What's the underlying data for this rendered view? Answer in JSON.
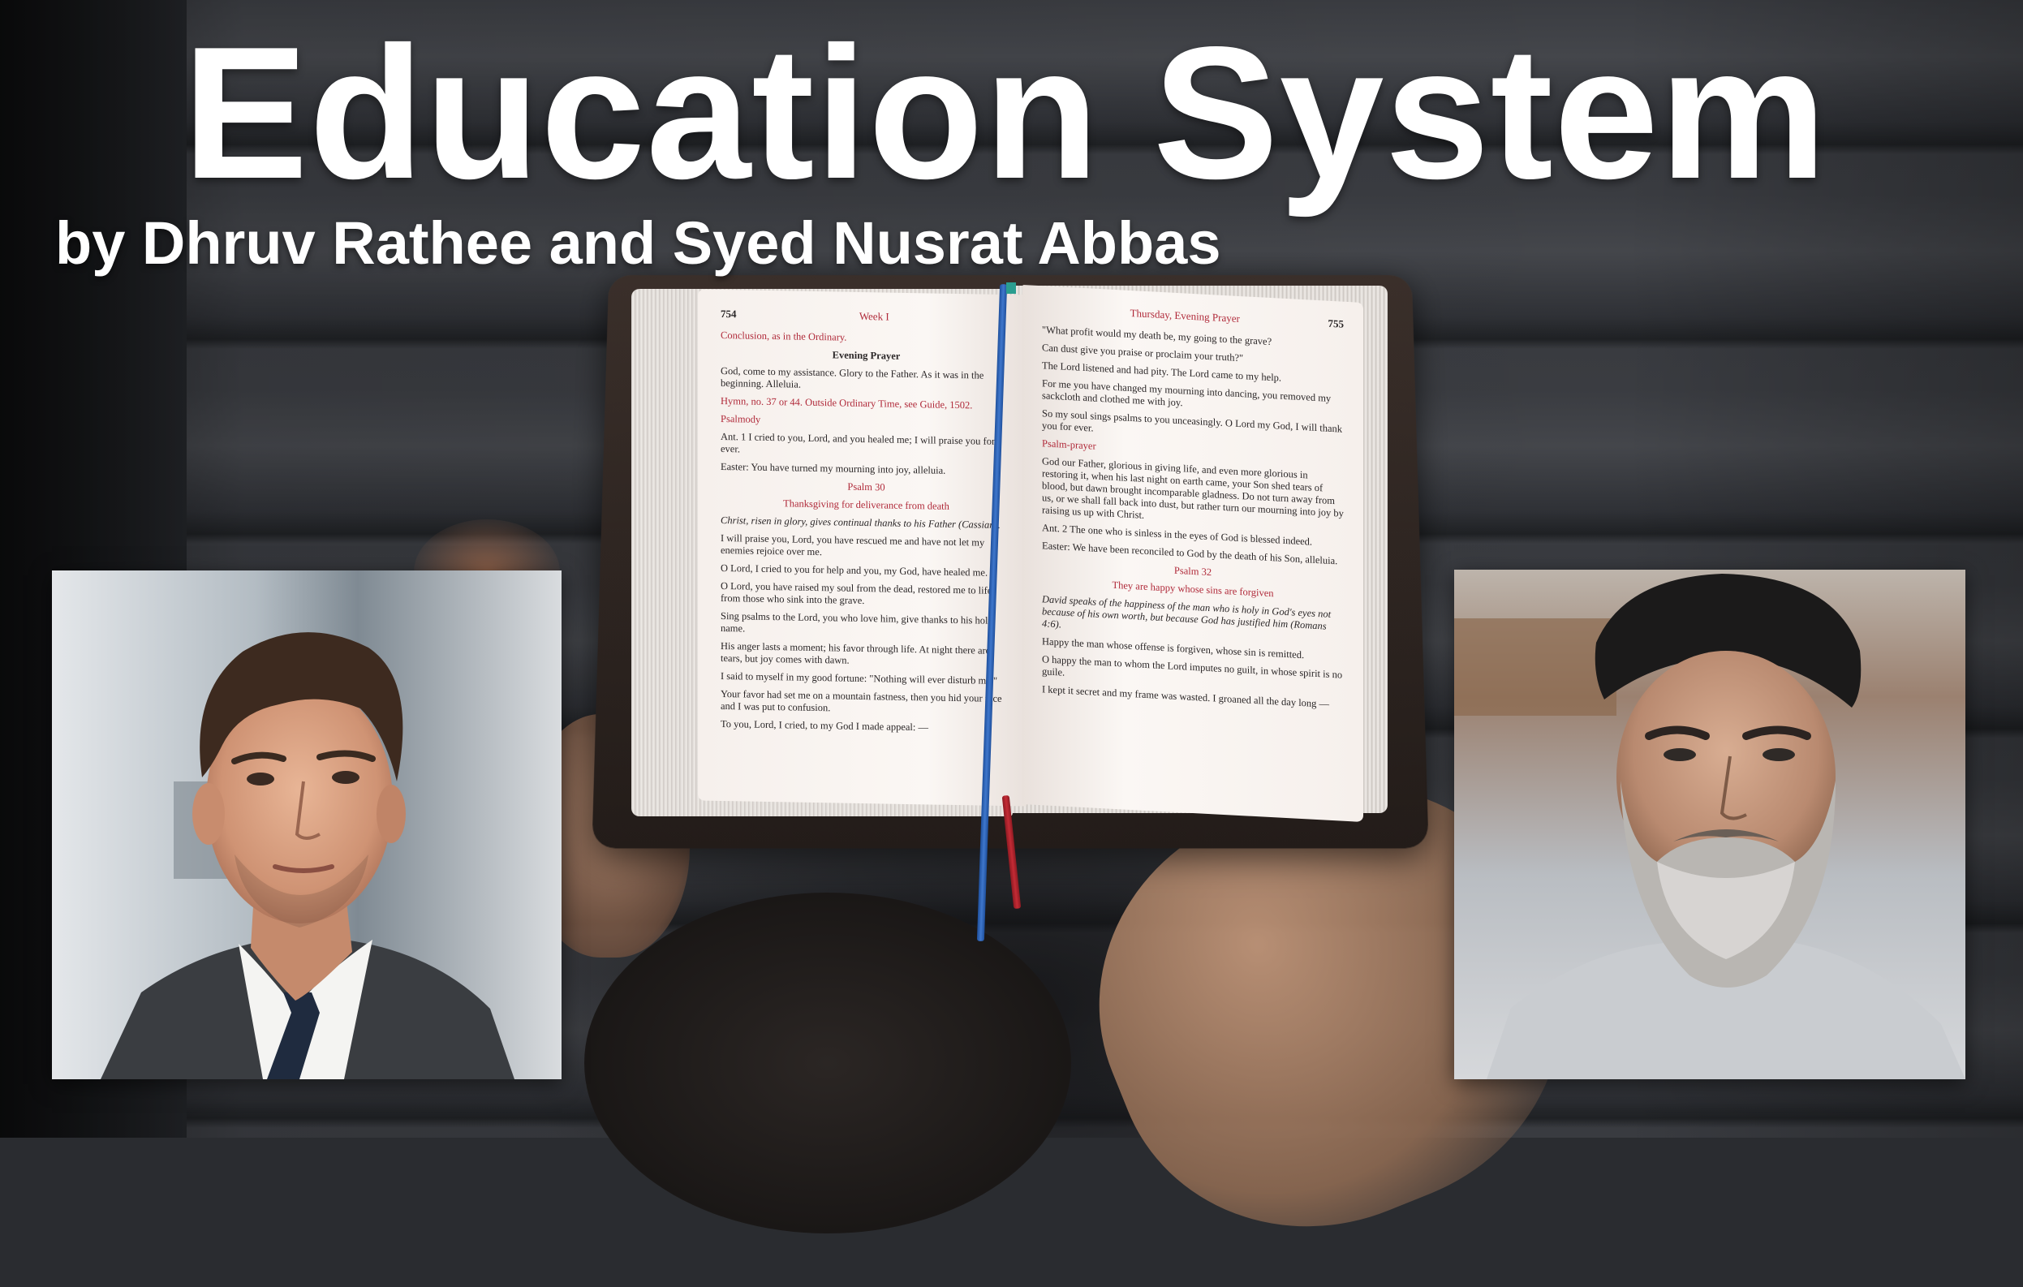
{
  "headline": {
    "title": "Education System",
    "subtitle": "by Dhruv Rathee and Syed Nusrat Abbas"
  },
  "book": {
    "left_page": {
      "page_number": "754",
      "running_head": "Week I",
      "line_1": "Conclusion, as in the Ordinary.",
      "heading": "Evening Prayer",
      "line_2": "God, come to my assistance. Glory to the Father. As it was in the beginning. Alleluia.",
      "line_3": "Hymn, no. 37 or 44. Outside Ordinary Time, see Guide, 1502.",
      "line_4": "Psalmody",
      "line_5": "Ant. 1  I cried to you, Lord, and you healed me; I will praise you for ever.",
      "line_6": "Easter: You have turned my mourning into joy, alleluia.",
      "line_7": "Psalm 30",
      "line_8": "Thanksgiving for deliverance from death",
      "line_9": "Christ, risen in glory, gives continual thanks to his Father (Cassian).",
      "line_10": "I will praise you, Lord, you have rescued me and have not let my enemies rejoice over me.",
      "line_11": "O Lord, I cried to you for help and you, my God, have healed me.",
      "line_12": "O Lord, you have raised my soul from the dead, restored me to life from those who sink into the grave.",
      "line_13": "Sing psalms to the Lord, you who love him, give thanks to his holy name.",
      "line_14": "His anger lasts a moment; his favor through life. At night there are tears, but joy comes with dawn.",
      "line_15": "I said to myself in my good fortune: \"Nothing will ever disturb me.\"",
      "line_16": "Your favor had set me on a mountain fastness, then you hid your face and I was put to confusion.",
      "line_17": "To you, Lord, I cried, to my God I made appeal: —"
    },
    "right_page": {
      "running_head": "Thursday, Evening Prayer",
      "page_number": "755",
      "line_1": "\"What profit would my death be, my going to the grave?",
      "line_2": "Can dust give you praise or proclaim your truth?\"",
      "line_3": "The Lord listened and had pity. The Lord came to my help.",
      "line_4": "For me you have changed my mourning into dancing, you removed my sackcloth and clothed me with joy.",
      "line_5": "So my soul sings psalms to you unceasingly. O Lord my God, I will thank you for ever.",
      "line_6": "Psalm-prayer",
      "line_7": "God our Father, glorious in giving life, and even more glorious in restoring it, when his last night on earth came, your Son shed tears of blood, but dawn brought incomparable gladness. Do not turn away from us, or we shall fall back into dust, but rather turn our mourning into joy by raising us up with Christ.",
      "line_8": "Ant. 2  The one who is sinless in the eyes of God is blessed indeed.",
      "line_9": "Easter: We have been reconciled to God by the death of his Son, alleluia.",
      "line_10": "Psalm 32",
      "line_11": "They are happy whose sins are forgiven",
      "line_12": "David speaks of the happiness of the man who is holy in God's eyes not because of his own worth, but because God has justified him (Romans 4:6).",
      "line_13": "Happy the man whose offense is forgiven, whose sin is remitted.",
      "line_14": "O happy the man to whom the Lord imputes no guilt, in whose spirit is no guile.",
      "line_15": "I kept it secret and my frame was wasted. I groaned all the day long —"
    }
  },
  "colors": {
    "title_text": "#ffffff",
    "rubric_red": "#b02a3a",
    "ribbon_blue": "#2f63b5",
    "ribbon_red": "#b3262f"
  }
}
